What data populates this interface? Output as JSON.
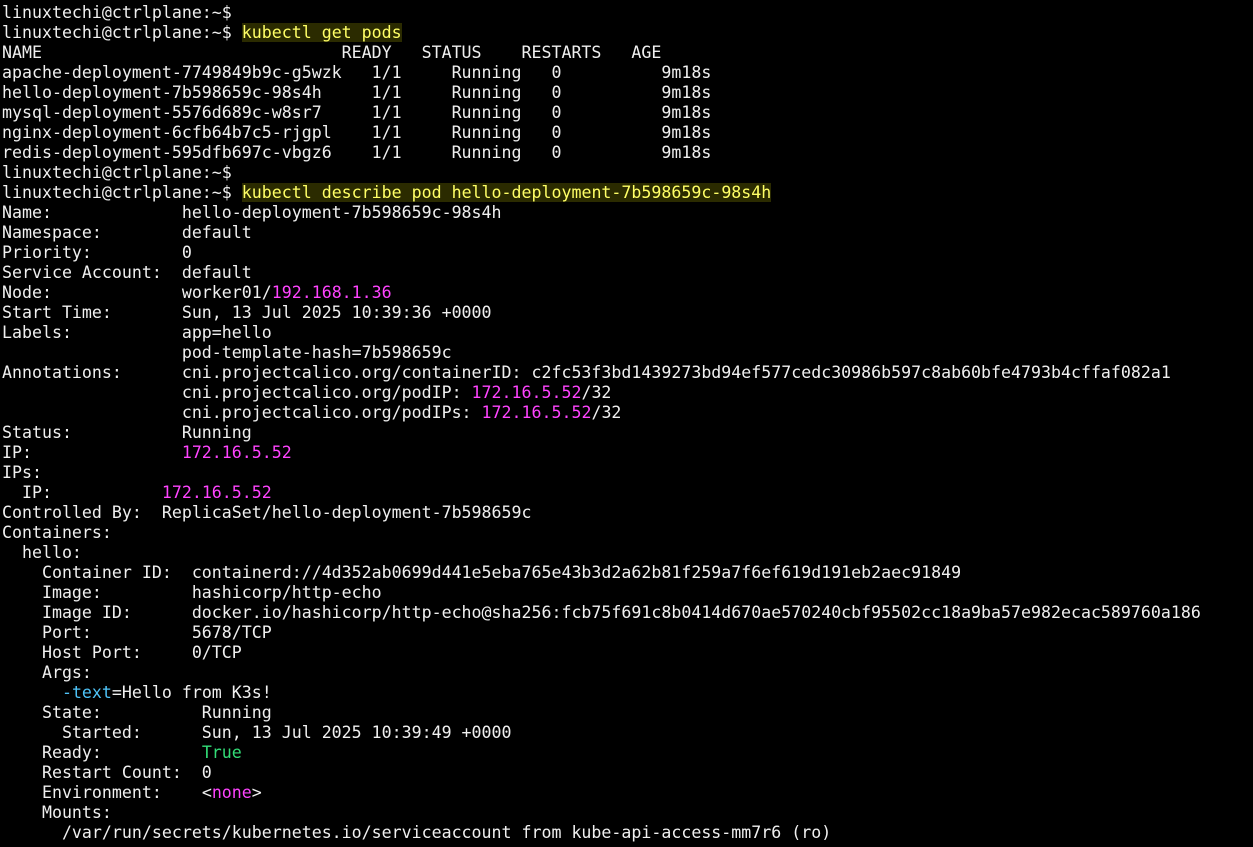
{
  "terminal": {
    "prompt": "linuxtechi@ctrlplane:~$",
    "cmd1": "kubectl get pods",
    "cmd2": "kubectl describe pod hello-deployment-7b598659c-98s4h",
    "pods": {
      "header": "NAME                              READY   STATUS    RESTARTS   AGE",
      "rows": [
        "apache-deployment-7749849b9c-g5wzk   1/1     Running   0          9m18s",
        "hello-deployment-7b598659c-98s4h     1/1     Running   0          9m18s",
        "mysql-deployment-5576d689c-w8sr7     1/1     Running   0          9m18s",
        "nginx-deployment-6cfb64b7c5-rjgpl    1/1     Running   0          9m18s",
        "redis-deployment-595dfb697c-vbgz6    1/1     Running   0          9m18s"
      ]
    },
    "describe": {
      "name": "Name:             hello-deployment-7b598659c-98s4h",
      "namespace": "Namespace:        default",
      "priority": "Priority:         0",
      "service_account": "Service Account:  default",
      "node_prefix": "Node:             worker01/",
      "node_ip": "192.168.1.36",
      "start_time": "Start Time:       Sun, 13 Jul 2025 10:39:36 +0000",
      "labels1": "Labels:           app=hello",
      "labels2": "                  pod-template-hash=7b598659c",
      "ann1": "Annotations:      cni.projectcalico.org/containerID: c2fc53f3bd1439273bd94ef577cedc30986b597c8ab60bfe4793b4cffaf082a1",
      "ann2_prefix": "                  cni.projectcalico.org/podIP: ",
      "ann2_ip": "172.16.5.52",
      "ann2_suffix": "/32",
      "ann3_prefix": "                  cni.projectcalico.org/podIPs: ",
      "ann3_ip": "172.16.5.52",
      "ann3_suffix": "/32",
      "status": "Status:           Running",
      "ip_prefix": "IP:               ",
      "ip_value": "172.16.5.52",
      "ips_label": "IPs:",
      "ips_prefix": "  IP:           ",
      "ips_value": "172.16.5.52",
      "controlled_by": "Controlled By:  ReplicaSet/hello-deployment-7b598659c",
      "containers": "Containers:",
      "hello": "  hello:",
      "container_id": "    Container ID:  containerd://4d352ab0699d441e5eba765e43b3d2a62b81f259a7f6ef619d191eb2aec91849",
      "image": "    Image:         hashicorp/http-echo",
      "image_id": "    Image ID:      docker.io/hashicorp/http-echo@sha256:fcb75f691c8b0414d670ae570240cbf95502cc18a9ba57e982ecac589760a186",
      "port": "    Port:          5678/TCP",
      "host_port": "    Host Port:     0/TCP",
      "args": "    Args:",
      "arg_indent": "      ",
      "arg_flag": "-text",
      "arg_value": "=Hello from K3s!",
      "state": "    State:          Running",
      "started": "      Started:      Sun, 13 Jul 2025 10:39:49 +0000",
      "ready_prefix": "    Ready:          ",
      "ready_value": "True",
      "restart_count": "    Restart Count:  0",
      "env_prefix": "    Environment:    ",
      "env_lt": "<",
      "env_none": "none",
      "env_gt": ">",
      "mounts": "    Mounts:",
      "mount1": "      /var/run/secrets/kubernetes.io/serviceaccount from kube-api-access-mm7r6 (ro)"
    }
  }
}
